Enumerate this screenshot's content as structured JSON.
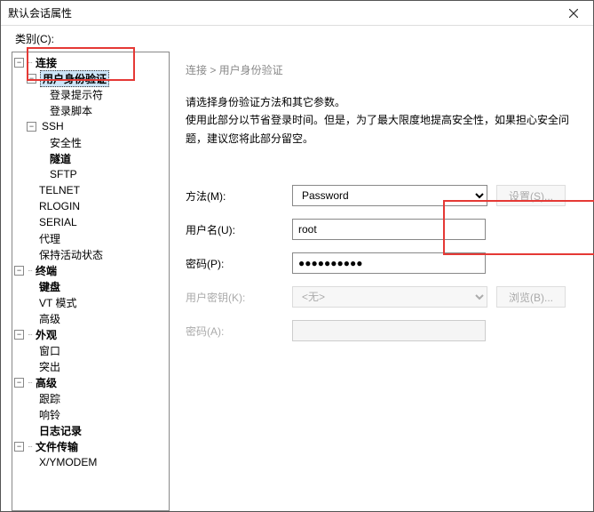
{
  "window": {
    "title": "默认会话属性"
  },
  "category_label": "类别(C):",
  "tree": {
    "n_connection": "连接",
    "n_auth": "用户身份验证",
    "n_login_prompt": "登录提示符",
    "n_login_script": "登录脚本",
    "n_ssh": "SSH",
    "n_security": "安全性",
    "n_tunnel": "隧道",
    "n_sftp": "SFTP",
    "n_telnet": "TELNET",
    "n_rlogin": "RLOGIN",
    "n_serial": "SERIAL",
    "n_proxy": "代理",
    "n_keepalive": "保持活动状态",
    "n_terminal": "终端",
    "n_keyboard": "键盘",
    "n_vtmode": "VT 模式",
    "n_advanced1": "高级",
    "n_appearance": "外观",
    "n_window": "窗口",
    "n_highlight": "突出",
    "n_advanced2": "高级",
    "n_trace": "跟踪",
    "n_bell": "响铃",
    "n_logging": "日志记录",
    "n_filetransfer": "文件传输",
    "n_xymodem": "X/YMODEM"
  },
  "breadcrumb": "连接 > 用户身份验证",
  "description": {
    "line1": "请选择身份验证方法和其它参数。",
    "line2": "使用此部分以节省登录时间。但是，为了最大限度地提高安全性，如果担心安全问题，建议您将此部分留空。"
  },
  "form": {
    "method_label": "方法(M):",
    "method_value": "Password",
    "settings_btn": "设置(S)...",
    "username_label": "用户名(U):",
    "username_value": "root",
    "password_label": "密码(P):",
    "password_value": "●●●●●●●●●●",
    "userkey_label": "用户密钥(K):",
    "userkey_value": "<无>",
    "browse_btn": "浏览(B)...",
    "password2_label": "密码(A):"
  }
}
